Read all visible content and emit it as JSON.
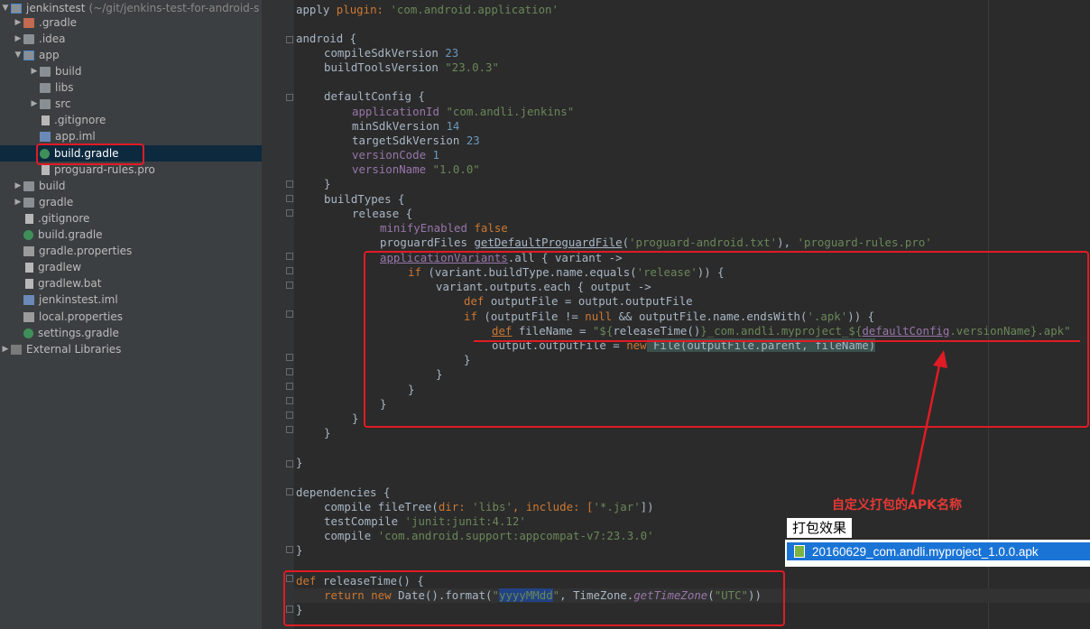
{
  "project_tree": {
    "root": {
      "label": "jenkinstest",
      "path": "(~/git/jenkins-test-for-android-s"
    },
    "items": [
      {
        "label": ".gradle"
      },
      {
        "label": ".idea"
      },
      {
        "label": "app"
      },
      {
        "label": "build"
      },
      {
        "label": "libs"
      },
      {
        "label": "src"
      },
      {
        "label": ".gitignore"
      },
      {
        "label": "app.iml"
      },
      {
        "label": "build.gradle"
      },
      {
        "label": "proguard-rules.pro"
      },
      {
        "label": "build"
      },
      {
        "label": "gradle"
      },
      {
        "label": ".gitignore"
      },
      {
        "label": "build.gradle"
      },
      {
        "label": "gradle.properties"
      },
      {
        "label": "gradlew"
      },
      {
        "label": "gradlew.bat"
      },
      {
        "label": "jenkinstest.iml"
      },
      {
        "label": "local.properties"
      },
      {
        "label": "settings.gradle"
      },
      {
        "label": "External Libraries"
      }
    ]
  },
  "code": {
    "apply_kw": "apply",
    "apply_plugin": " plugin: ",
    "apply_val": "'com.android.application'",
    "android": "android {",
    "compile_sdk": "compileSdkVersion ",
    "compile_sdk_val": "23",
    "build_tools": "buildToolsVersion ",
    "build_tools_val": "\"23.0.3\"",
    "default_config": "defaultConfig {",
    "app_id": "applicationId ",
    "app_id_val": "\"com.andli.jenkins\"",
    "min_sdk": "minSdkVersion ",
    "min_sdk_val": "14",
    "target_sdk": "targetSdkVersion ",
    "target_sdk_val": "23",
    "version_code": "versionCode ",
    "version_code_val": "1",
    "version_name": "versionName ",
    "version_name_val": "\"1.0.0\"",
    "close": "}",
    "build_types": "buildTypes {",
    "release": "release {",
    "minify": "minifyEnabled ",
    "minify_val": "false",
    "proguard": "proguardFiles ",
    "proguard_fn": "getDefaultProguardFile",
    "proguard_arg1": "'proguard-android.txt'",
    "proguard_sep": "), ",
    "proguard_arg2": "'proguard-rules.pro'",
    "app_variants": "applicationVariants",
    "variants_rest": ".all { variant ->",
    "if1_kw": "if",
    "if1_rest": " (variant.buildType.name.equals(",
    "if1_str": "'release'",
    "if1_end": ")) {",
    "outputs_each": "variant.outputs.each { output ->",
    "def1_kw": "def",
    "def1_rest": " outputFile = output.outputFile",
    "if2_kw": "if",
    "if2_a": " (outputFile != ",
    "if2_null": "null",
    "if2_b": " && outputFile.name.endsWith(",
    "if2_str": "'.apk'",
    "if2_end": ")) {",
    "def2_kw": "def",
    "def2_a": " fileName = ",
    "def2_str1": "\"${",
    "def2_call": "releaseTime()",
    "def2_str2": "}_com.andli.myproject_${",
    "def2_field": "defaultConfig",
    "def2_str3": ".versionName}.apk\"",
    "assign_a": "output.outputFile = ",
    "assign_new": "new",
    "assign_b": " File(outputFile.parent, fileName)",
    "dependencies": "dependencies {",
    "compile": "compile ",
    "file_tree": "fileTree(",
    "dir_kw": "dir: ",
    "dir_val": "'libs'",
    "include_kw": ", include: [",
    "include_val": "'*.jar'",
    "file_tree_end": "])",
    "test_compile": "testCompile ",
    "test_compile_val": "'junit:junit:4.12'",
    "compile2": "compile ",
    "compile2_val": "'com.android.support:appcompat-v7:23.3.0'",
    "def3_kw": "def",
    "def3_rest": " releaseTime() {",
    "return_kw": "return new",
    "return_a": " Date().format(",
    "return_q1": "\"",
    "return_fmt": "yyyyMMdd",
    "return_q2": "\"",
    "return_b": ", TimeZone.",
    "return_tz": "getTimeZone",
    "return_c": "(",
    "return_utc": "\"UTC\"",
    "return_d": "))"
  },
  "annotations": {
    "custom_name_note": "自定义打包的APK名称",
    "result_label": "打包效果",
    "result_file": "20160629_com.andli.myproject_1.0.0.apk"
  },
  "colors": {
    "annotation_red": "#e01b24",
    "selection_blue": "#1a74d6",
    "editor_bg": "#2b2b2b",
    "sidebar_bg": "#3c3f41"
  }
}
